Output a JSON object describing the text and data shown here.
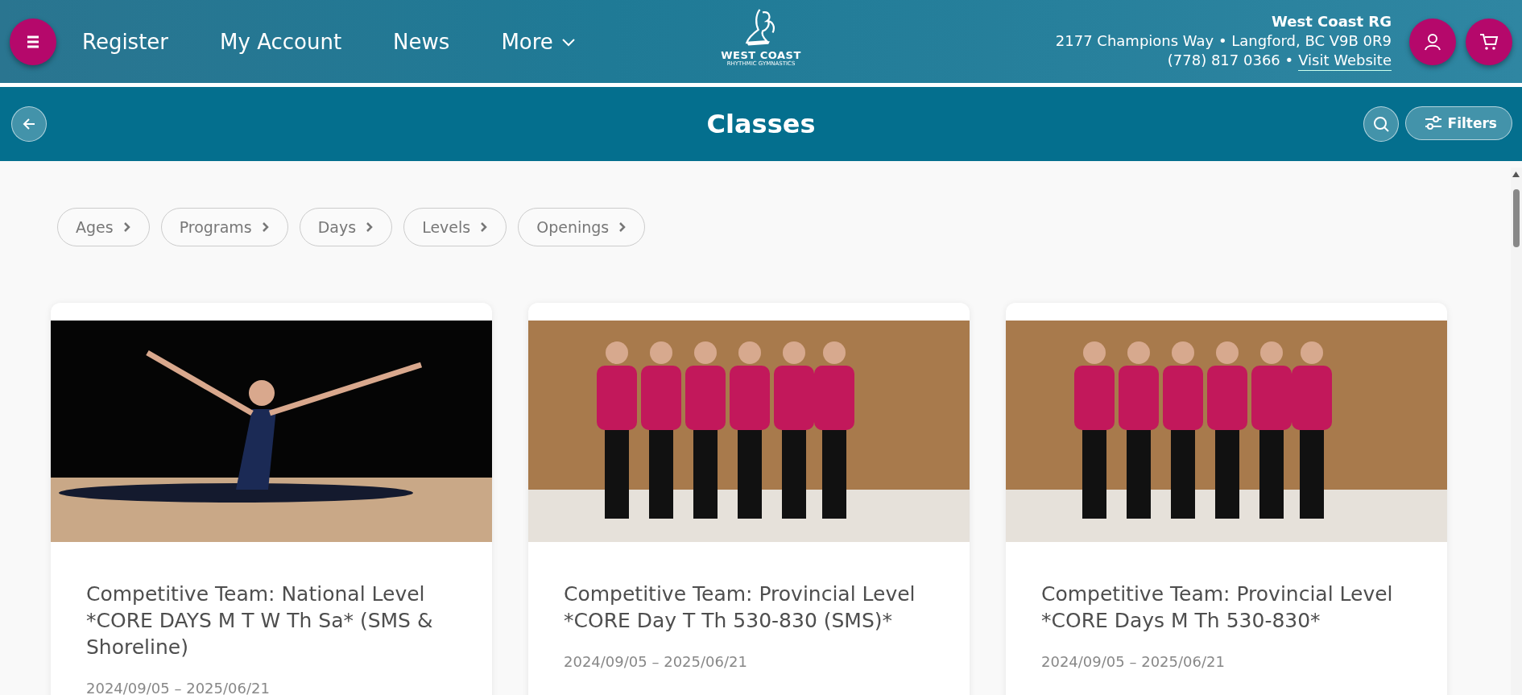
{
  "nav": {
    "links": [
      "Register",
      "My Account",
      "News"
    ],
    "more": "More"
  },
  "logo": {
    "name": "WEST COAST",
    "tagline": "RHYTHMIC GYMNASTICS"
  },
  "club": {
    "name": "West Coast RG",
    "address": "2177 Champions Way • Langford, BC V9B 0R9",
    "phone": "(778) 817 0366 •",
    "link": "Visit Website"
  },
  "titlebar": {
    "title": "Classes",
    "filters": "Filters"
  },
  "chips": [
    "Ages",
    "Programs",
    "Days",
    "Levels",
    "Openings"
  ],
  "cards": [
    {
      "kind": "solo",
      "title": "Competitive Team: National Level *CORE DAYS M T W Th Sa* (SMS & Shoreline)",
      "dates": "2024/09/05 – 2025/06/21"
    },
    {
      "kind": "team",
      "title": "Competitive Team: Provincial Level *CORE Day T Th 530-830 (SMS)*",
      "dates": "2024/09/05 – 2025/06/21"
    },
    {
      "kind": "team",
      "title": "Competitive Team: Provincial Level *CORE Days M Th 530-830*",
      "dates": "2024/09/05 – 2025/06/21"
    }
  ]
}
